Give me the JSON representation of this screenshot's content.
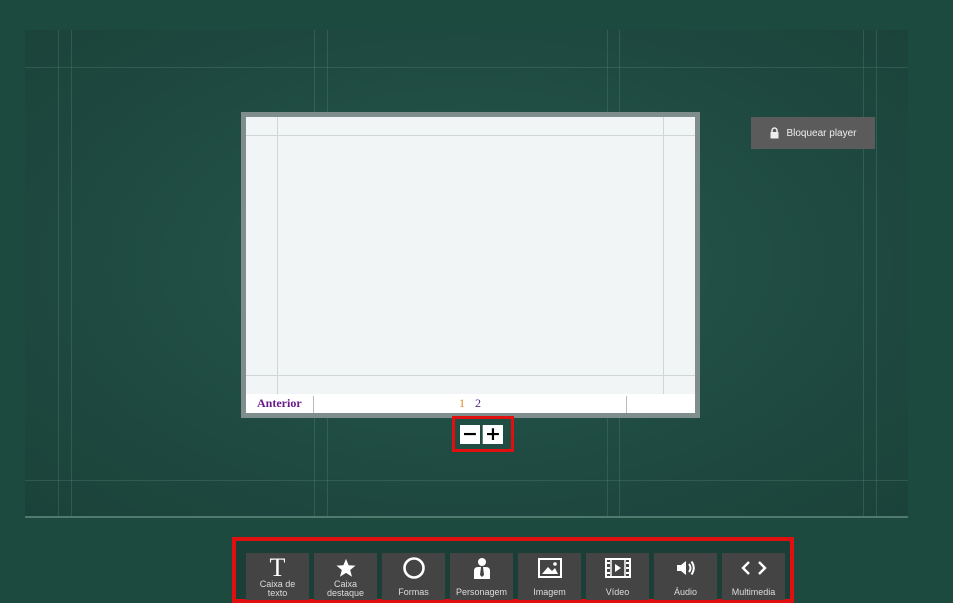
{
  "lock_player": {
    "label": "Bloquear player",
    "icon": "lock-icon"
  },
  "slide": {
    "footer": {
      "prev_label": "Anterior",
      "pages": [
        "1",
        "2"
      ],
      "current_page": "1"
    }
  },
  "zoom": {
    "minus": "−",
    "plus": "+"
  },
  "toolbar": {
    "tools": [
      {
        "label": "Caixa de texto",
        "icon": "text-icon"
      },
      {
        "label": "Caixa destaque",
        "icon": "star-icon"
      },
      {
        "label": "Formas",
        "icon": "circle-icon"
      },
      {
        "label": "Personagem",
        "icon": "person-icon"
      },
      {
        "label": "Imagem",
        "icon": "image-icon"
      },
      {
        "label": "Vídeo",
        "icon": "film-icon"
      },
      {
        "label": "Áudio",
        "icon": "speaker-icon"
      },
      {
        "label": "Multimedia",
        "icon": "code-icon"
      }
    ]
  },
  "colors": {
    "background": "#1d4a3e",
    "highlight_border": "#e01010",
    "tool_button": "#444444",
    "current_page": "#e08a1e",
    "link": "#6a1b8a"
  }
}
